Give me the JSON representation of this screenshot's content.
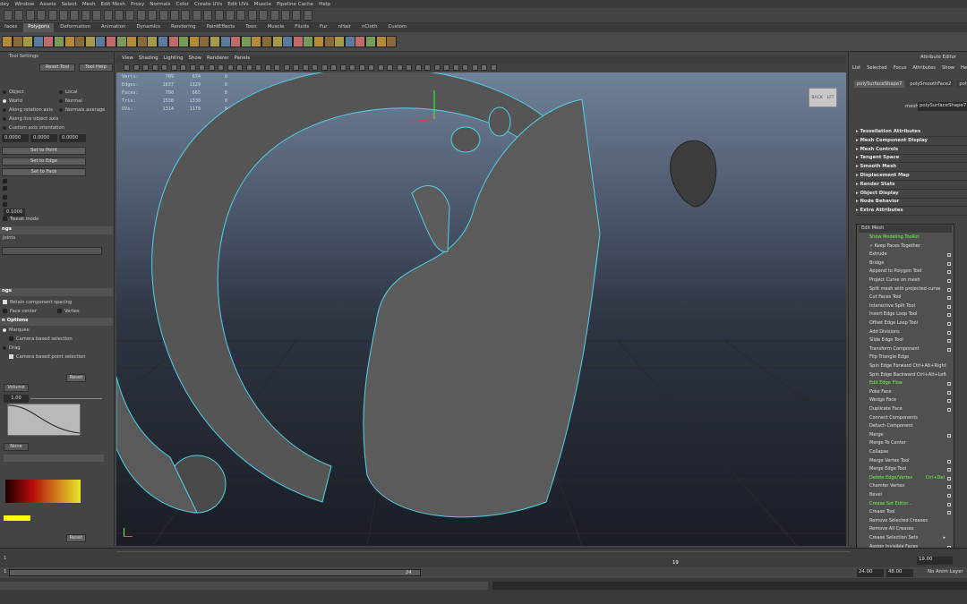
{
  "menubar": [
    "dey",
    "Window",
    "Assets",
    "Select",
    "Mesh",
    "Edit Mesh",
    "Proxy",
    "Normals",
    "Color",
    "Create UVs",
    "Edit UVs",
    "Muscle",
    "Pipeline Cache",
    "Help"
  ],
  "shelf_tabs": [
    "faces",
    "Polygons",
    "Deformation",
    "Animation",
    "Dynamics",
    "Rendering",
    "PaintEffects",
    "Toon",
    "Muscle",
    "Fluids",
    "Fur",
    "nHair",
    "nCloth",
    "Custom"
  ],
  "shelf_active": "Polygons",
  "tool_settings": {
    "title": "Tool Settings",
    "reset": "Reset Tool",
    "help": "Tool Help",
    "opt_object": "Object",
    "opt_local": "Local",
    "opt_world": "World",
    "opt_normal": "Normal",
    "opt_rot": "Along rotation axis",
    "opt_normavg": "Normals average",
    "opt_live": "Along live object axis",
    "opt_custom": "Custom axis orientation",
    "val1": "0.0000",
    "val2": "0.0000",
    "val3": "0.0000",
    "set_point": "Set to Point",
    "set_edge": "Set to Edge",
    "set_face": "Set to Face",
    "val4": "0.1000",
    "tweak": "Tweak mode",
    "sec_ngs": "ngs",
    "joints": "Joints",
    "sec_ngs2": "ngs",
    "retain": "Retain component spacing",
    "face_center": "Face center",
    "vertex": "Vertex",
    "sec_opt": "n Options",
    "marquee": "Marquee",
    "cam1": "Camera based selection",
    "drag": "Drag",
    "cam2": "Camera based point selection",
    "reset2": "Reset",
    "reset3": "Reset",
    "dd_volume": "Volume",
    "dd_none": "None",
    "val5": "1.00"
  },
  "viewport": {
    "menu": [
      "View",
      "Shading",
      "Lighting",
      "Show",
      "Renderer",
      "Panels"
    ],
    "hud": [
      {
        "label": "Verts:",
        "a": "789",
        "b": "674",
        "c": "0"
      },
      {
        "label": "Edges:",
        "a": "1637",
        "b": "1329",
        "b2": "",
        "c": "0"
      },
      {
        "label": "Faces:",
        "a": "790",
        "b": "665",
        "c": "0"
      },
      {
        "label": "Tris:",
        "a": "1530",
        "b": "1330",
        "c": "0"
      },
      {
        "label": "UVs:",
        "a": "1314",
        "b": "1179",
        "c": "0"
      }
    ],
    "viewcube": {
      "left": "BACK",
      "right": "LFT"
    }
  },
  "attribute_editor": {
    "title": "Attribute Editor",
    "menu": [
      "List",
      "Selected",
      "Focus",
      "Attributes",
      "Show",
      "Help"
    ],
    "tabs": [
      "polySurfaceShape7",
      "polySmoothFace2",
      "polyT"
    ],
    "mesh_label": "mesh:",
    "mesh_value": "polySurfaceShape7",
    "sections": [
      "Tessellation Attributes",
      "Mesh Component Display",
      "Mesh Controls",
      "Tangent Space",
      "Smooth Mesh",
      "Displacement Map",
      "Render Stats",
      "Object Display",
      "Node Behavior",
      "Extra Attributes"
    ]
  },
  "edit_mesh": {
    "title": "Edit Mesh",
    "items": [
      {
        "label": "Show Modeling Toolkit",
        "hl": true,
        "box": false
      },
      {
        "label": "Keep Faces Together",
        "check": true,
        "box": false
      },
      {
        "label": "Extrude",
        "box": true
      },
      {
        "label": "Bridge",
        "box": true
      },
      {
        "label": "Append to Polygon Tool",
        "box": true
      },
      {
        "label": "Project Curve on mesh",
        "box": true
      },
      {
        "label": "Split mesh with projected curve",
        "box": true
      },
      {
        "label": "Cut Faces Tool",
        "box": true
      },
      {
        "label": "Interactive Split Tool",
        "box": true
      },
      {
        "label": "Insert Edge Loop Tool",
        "box": true
      },
      {
        "label": "Offset Edge Loop Tool",
        "box": true
      },
      {
        "label": "Add Divisions",
        "box": true
      },
      {
        "label": "Slide Edge Tool",
        "box": true
      },
      {
        "label": "Transform Component",
        "box": true
      },
      {
        "label": "Flip Triangle Edge",
        "box": false
      },
      {
        "label": "Spin Edge Forward  Ctrl+Alt+Right",
        "box": false
      },
      {
        "label": "Spin Edge Backward  Ctrl+Alt+Left",
        "box": false
      },
      {
        "label": "Edit Edge Flow",
        "hl": true,
        "box": true
      },
      {
        "label": "Poke Face",
        "box": true
      },
      {
        "label": "Wedge Face",
        "box": true
      },
      {
        "label": "Duplicate Face",
        "box": true
      },
      {
        "label": "Connect Components",
        "box": false
      },
      {
        "label": "Detach Component",
        "box": false
      },
      {
        "label": "Merge",
        "box": true
      },
      {
        "label": "Merge To Center",
        "box": false
      },
      {
        "label": "Collapse",
        "box": false
      },
      {
        "label": "Merge Vertex Tool",
        "box": true
      },
      {
        "label": "Merge Edge Tool",
        "box": true
      },
      {
        "label": "Delete Edge/Vertex",
        "hl": true,
        "shortcut": "Ctrl+Del",
        "box": true
      },
      {
        "label": "Chamfer Vertex",
        "box": true
      },
      {
        "label": "Bevel",
        "box": true
      },
      {
        "label": "Crease Set Editor...",
        "hl": true,
        "box": true
      },
      {
        "label": "Crease Tool",
        "box": true
      },
      {
        "label": "Remove Selected Creases",
        "box": false
      },
      {
        "label": "Remove All Creases",
        "box": false
      },
      {
        "label": "Crease Selection Sets",
        "box": false,
        "arrow": true
      },
      {
        "label": "Assign Invisible Faces",
        "box": true
      }
    ]
  },
  "timeline": {
    "ticks": [
      "1",
      "24"
    ],
    "current_frame": "19",
    "frame_field": "19.00",
    "start": "1",
    "range_end_mid": "24",
    "end1": "24.00",
    "end2": "48.00",
    "anim_layer": "No Anim Layer"
  },
  "colors": {
    "accent_green": "#6bff4a",
    "wire": "#4fd3e8",
    "panel": "#444444"
  }
}
